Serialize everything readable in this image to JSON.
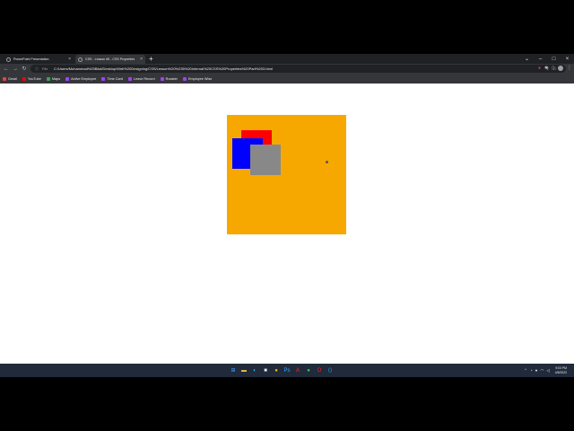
{
  "browser": {
    "tabs": [
      {
        "title": "PowerPoint Presentation",
        "active": false
      },
      {
        "title": "CSS - Lesson #5 - CSS Properties",
        "active": true
      }
    ],
    "new_tab_icon": "+",
    "address": {
      "info_icon": "ⓘ",
      "scheme_label": "File",
      "url": "C:/Users/Muhammad%20Bilal/Desktop/Web%20Designing/CSS/Lesson%20%235%20Internal%20CSS%20Properties%20Part%203.html"
    },
    "bookmarks": [
      {
        "label": "Gmail",
        "color": "#ea4335"
      },
      {
        "label": "YouTube",
        "color": "#ff0000"
      },
      {
        "label": "Maps",
        "color": "#34a853"
      },
      {
        "label": "Active Employee",
        "color": "#a142f4"
      },
      {
        "label": "Time Card",
        "color": "#a142f4"
      },
      {
        "label": "Leave Record",
        "color": "#a142f4"
      },
      {
        "label": "Roaster",
        "color": "#a142f4"
      },
      {
        "label": "Employee Wise",
        "color": "#a142f4"
      }
    ]
  },
  "page": {
    "parent_box_color": "#f7a800",
    "children": [
      {
        "name": "red-square",
        "color": "#ff0000"
      },
      {
        "name": "blue-square",
        "color": "#0000ff"
      },
      {
        "name": "gray-square",
        "color": "#888888"
      }
    ]
  },
  "taskbar": {
    "apps": [
      {
        "name": "windows-start-icon",
        "glyph": "⊞",
        "color": "#3b9cff"
      },
      {
        "name": "file-explorer-icon",
        "glyph": "▬",
        "color": "#f5c542"
      },
      {
        "name": "edge-icon",
        "glyph": "◐",
        "color": "#2fb7e6"
      },
      {
        "name": "store-icon",
        "glyph": "■",
        "color": "#e8eaed"
      },
      {
        "name": "chrome-icon",
        "glyph": "●",
        "color": "#fbbc05"
      },
      {
        "name": "photoshop-icon",
        "glyph": "Ps",
        "color": "#31a8ff"
      },
      {
        "name": "acrobat-icon",
        "glyph": "A",
        "color": "#ff2a2a"
      },
      {
        "name": "whatsapp-icon",
        "glyph": "●",
        "color": "#25d366"
      },
      {
        "name": "opera-icon",
        "glyph": "O",
        "color": "#ff1b2d"
      },
      {
        "name": "vscode-icon",
        "glyph": "⟨⟩",
        "color": "#23a8f2"
      }
    ],
    "clock": {
      "time": "9:03 PM",
      "date": "4/8/2022"
    }
  }
}
